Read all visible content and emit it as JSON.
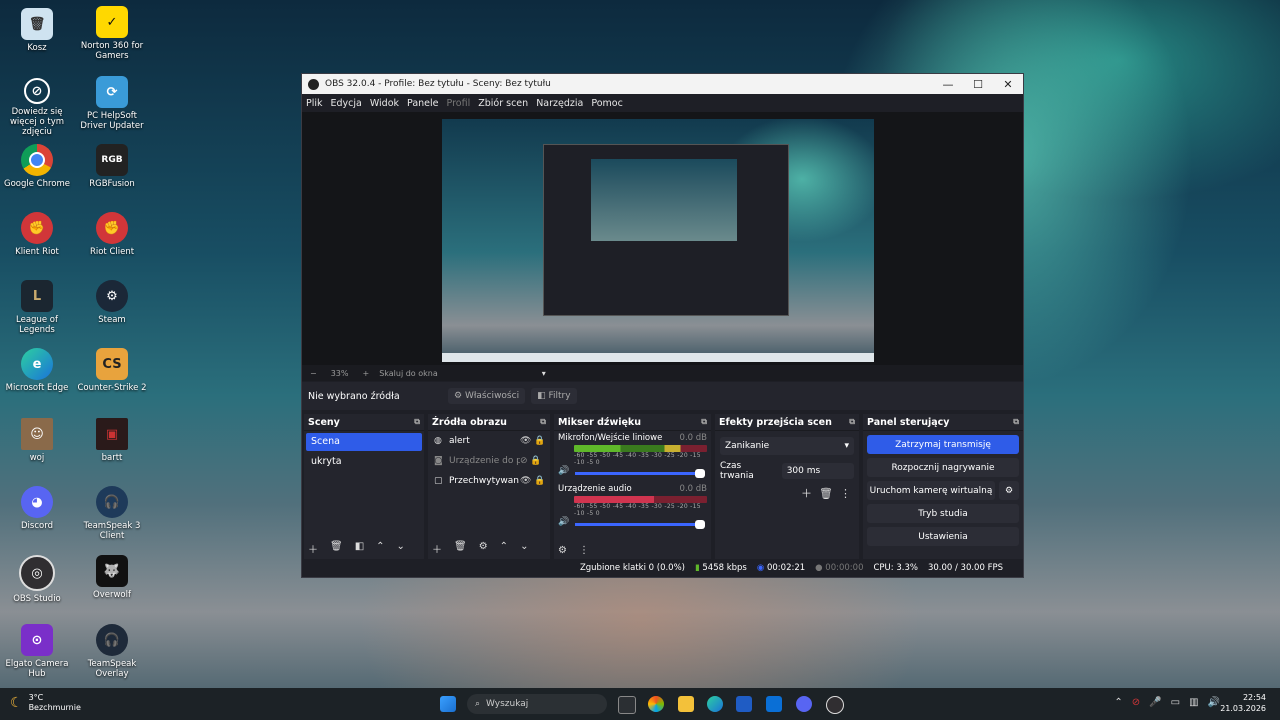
{
  "desktop": {
    "icons": [
      {
        "label": "Kosz",
        "icon": "recycle-bin-icon"
      },
      {
        "label": "Norton 360 for Gamers",
        "icon": "norton-icon"
      },
      {
        "label": "Dowiedz się więcej o tym zdjęciu",
        "icon": "info-camera-icon"
      },
      {
        "label": "PC HelpSoft Driver Updater",
        "icon": "driver-updater-icon"
      },
      {
        "label": "Google Chrome",
        "icon": "chrome-icon"
      },
      {
        "label": "RGBFusion",
        "icon": "rgbfusion-icon"
      },
      {
        "label": "Klient Riot",
        "icon": "riot-icon"
      },
      {
        "label": "Riot Client",
        "icon": "riot-icon"
      },
      {
        "label": "League of Legends",
        "icon": "league-icon"
      },
      {
        "label": "Steam",
        "icon": "steam-icon"
      },
      {
        "label": "Microsoft Edge",
        "icon": "edge-icon"
      },
      {
        "label": "Counter-Strike 2",
        "icon": "cs2-icon"
      },
      {
        "label": "woj",
        "icon": "user-folder-icon"
      },
      {
        "label": "bartt",
        "icon": "user-folder-icon"
      },
      {
        "label": "Discord",
        "icon": "discord-icon"
      },
      {
        "label": "TeamSpeak 3 Client",
        "icon": "teamspeak-icon"
      },
      {
        "label": "OBS Studio",
        "icon": "obs-icon"
      },
      {
        "label": "Overwolf",
        "icon": "overwolf-icon"
      },
      {
        "label": "Elgato Camera Hub",
        "icon": "elgato-icon"
      },
      {
        "label": "TeamSpeak Overlay",
        "icon": "teamspeak-overlay-icon"
      }
    ]
  },
  "window": {
    "title": "OBS 32.0.4 - Profile: Bez tytułu - Sceny: Bez tytułu",
    "menu": [
      "Plik",
      "Edycja",
      "Widok",
      "Panele",
      "Profil",
      "Zbiór scen",
      "Narzędzia",
      "Pomoc"
    ],
    "zoom": {
      "minus": "−",
      "value": "33%",
      "plus": "+",
      "fit": "Skaluj do okna"
    },
    "source_bar": {
      "no_source": "Nie wybrano źródła",
      "properties": "Właściwości",
      "filters": "Filtry"
    }
  },
  "scenes": {
    "title": "Sceny",
    "items": [
      {
        "label": "Scena",
        "selected": true
      },
      {
        "label": "ukryta",
        "selected": false
      }
    ]
  },
  "sources": {
    "title": "Źródła obrazu",
    "items": [
      {
        "label": "alert",
        "icon": "browser-source-icon",
        "dim": false
      },
      {
        "label": "Urządzenie do p",
        "icon": "camera-source-icon",
        "dim": true
      },
      {
        "label": "Przechwytywan",
        "icon": "display-capture-icon",
        "dim": false
      }
    ]
  },
  "mixer": {
    "title": "Mikser dźwięku",
    "channels": [
      {
        "name": "Mikrofon/Wejście liniowe",
        "db": "0.0 dB",
        "meter_color": "#7fd13b"
      },
      {
        "name": "Urządzenie audio",
        "db": "0.0 dB",
        "meter_color": "#d0344f"
      }
    ],
    "ticks": "-60 -55 -50 -45 -40 -35 -30 -25 -20 -15 -10 -5 0"
  },
  "transitions": {
    "title": "Efekty przejścia scen",
    "selected": "Zanikanie",
    "duration_label": "Czas trwania",
    "duration_value": "300 ms"
  },
  "controls": {
    "title": "Panel sterujący",
    "buttons": [
      "Zatrzymaj transmisję",
      "Rozpocznij nagrywanie",
      "Uruchom kamerę wirtualną",
      "Tryb studia",
      "Ustawienia"
    ]
  },
  "status": {
    "dropped": "Zgubione klatki 0 (0.0%)",
    "bitrate": "5458 kbps",
    "stream_time": "00:02:21",
    "rec_time": "00:00:00",
    "cpu": "CPU: 3.3%",
    "fps": "30.00 / 30.00 FPS"
  },
  "taskbar": {
    "weather_temp": "3°C",
    "weather_desc": "Bezchmurnie",
    "search": "Wyszukaj",
    "time": "22:54",
    "date": "21.03.2026"
  },
  "colors": {
    "accent": "#2f5ce8",
    "panel": "#24252d",
    "window": "#1e1f26"
  }
}
